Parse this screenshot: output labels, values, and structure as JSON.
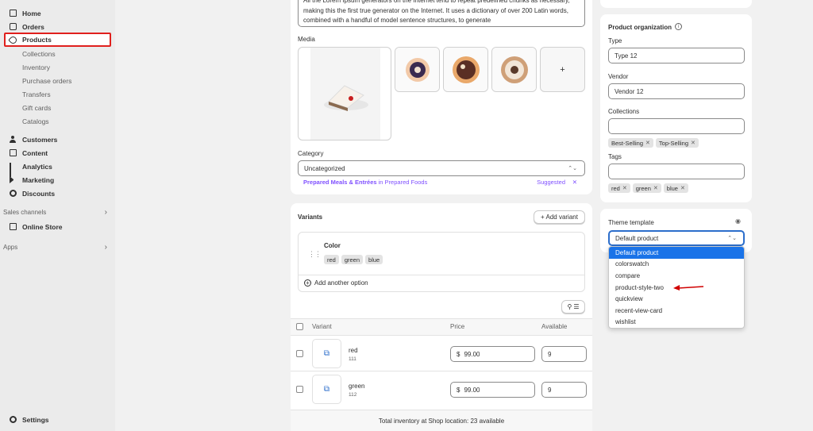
{
  "sidebar": {
    "nav": [
      {
        "label": "Home",
        "icon": "home-icon"
      },
      {
        "label": "Orders",
        "icon": "orders-icon"
      },
      {
        "label": "Products",
        "icon": "tag-icon"
      }
    ],
    "product_sub": [
      "Collections",
      "Inventory",
      "Purchase orders",
      "Transfers",
      "Gift cards",
      "Catalogs"
    ],
    "nav2": [
      {
        "label": "Customers",
        "icon": "person-icon"
      },
      {
        "label": "Content",
        "icon": "content-icon"
      },
      {
        "label": "Analytics",
        "icon": "analytics-icon"
      },
      {
        "label": "Marketing",
        "icon": "megaphone-icon"
      },
      {
        "label": "Discounts",
        "icon": "discount-icon"
      }
    ],
    "sales_channels_label": "Sales channels",
    "online_store": "Online Store",
    "apps_label": "Apps",
    "settings": "Settings",
    "highlight_color": "#e0201d"
  },
  "description": {
    "text": "All the Lorem Ipsum generators on the Internet tend to repeat predefined chunks as necessary, making this the first true generator on the Internet. It uses a dictionary of over 200 Latin words, combined with a handful of model sentence structures, to generate"
  },
  "media": {
    "label": "Media",
    "add_symbol": "+"
  },
  "category": {
    "label": "Category",
    "value": "Uncategorized",
    "suggestion_name": "Prepared Meals & Entrées",
    "suggestion_in": "in Prepared Foods",
    "suggested_label": "Suggested",
    "dismiss": "✕",
    "accent_color": "#8051ff"
  },
  "variants": {
    "title": "Variants",
    "add_variant": "+ Add variant",
    "option_name": "Color",
    "option_values": [
      "red",
      "green",
      "blue"
    ],
    "add_option": "Add another option",
    "columns": {
      "variant": "Variant",
      "price": "Price",
      "available": "Available"
    },
    "rows": [
      {
        "name": "red",
        "sku": "111",
        "currency": "$",
        "price": "99.00",
        "available": "9"
      },
      {
        "name": "green",
        "sku": "112",
        "currency": "$",
        "price": "99.00",
        "available": "9"
      }
    ],
    "total_inventory": "Total inventory at Shop location: 23 available"
  },
  "organization": {
    "title": "Product organization",
    "type_label": "Type",
    "type_value": "Type 12",
    "vendor_label": "Vendor",
    "vendor_value": "Vendor 12",
    "collections_label": "Collections",
    "collections": [
      "Best-Selling",
      "Top-Selling"
    ],
    "tags_label": "Tags",
    "tags": [
      "red",
      "green",
      "blue"
    ]
  },
  "theme_template": {
    "label": "Theme template",
    "selected": "Default product",
    "options": [
      "Default product",
      "colorswatch",
      "compare",
      "product-style-two",
      "quickview",
      "recent-view-card",
      "wishlist"
    ],
    "selected_color": "#1a73e8",
    "annotation_color": "#d00000"
  }
}
